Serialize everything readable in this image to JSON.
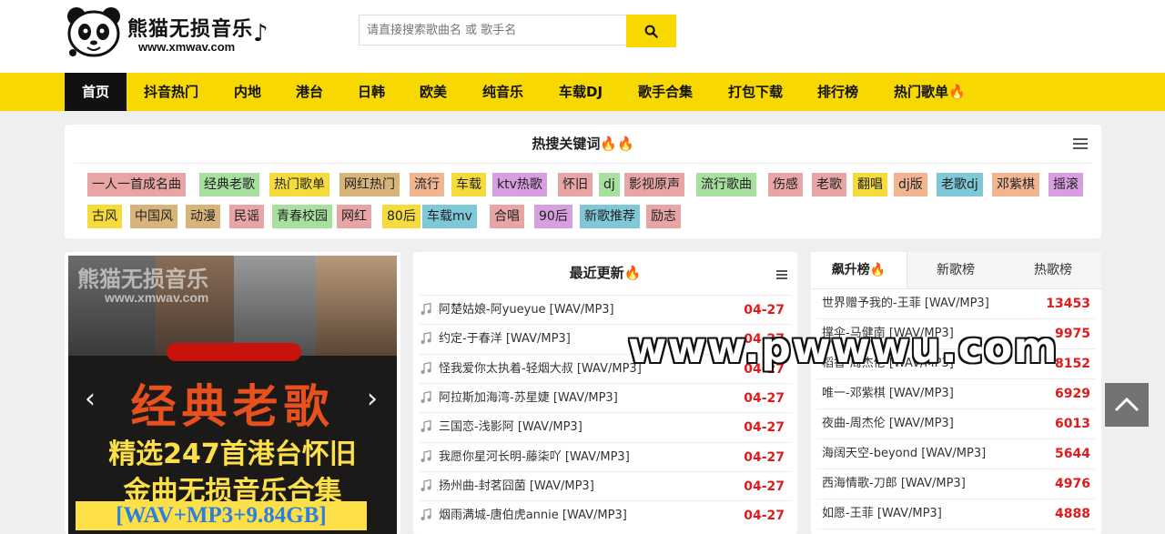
{
  "logo": {
    "title": "熊猫无损音乐",
    "url": "www.xmwav.com"
  },
  "search": {
    "placeholder": "请直接搜索歌曲名 或 歌手名",
    "icon": "search-icon"
  },
  "nav": [
    {
      "label": "首页",
      "active": true
    },
    {
      "label": "抖音热门"
    },
    {
      "label": "内地"
    },
    {
      "label": "港台"
    },
    {
      "label": "日韩"
    },
    {
      "label": "欧美"
    },
    {
      "label": "纯音乐"
    },
    {
      "label": "车载DJ"
    },
    {
      "label": "歌手合集"
    },
    {
      "label": "打包下载"
    },
    {
      "label": "排行榜"
    },
    {
      "label": "热门歌单"
    }
  ],
  "hot_keywords": {
    "title": "热搜关键词",
    "tags": [
      {
        "label": "一人一首成名曲",
        "color": "#e8a5a5"
      },
      {
        "label": "经典老歌",
        "color": "#a8e0a0"
      },
      {
        "label": "热门歌单",
        "color": "#f5dc3c"
      },
      {
        "label": "网红热门",
        "color": "#d8b47a"
      },
      {
        "label": "流行",
        "color": "#f2b592"
      },
      {
        "label": "车载",
        "color": "#f5dc3c"
      },
      {
        "label": "ktv热歌",
        "color": "#d79ee0"
      },
      {
        "label": "怀旧",
        "color": "#e8a5a5"
      },
      {
        "label": "dj",
        "color": "#a8e0a0"
      },
      {
        "label": "影视原声",
        "color": "#e8a5a5"
      },
      {
        "label": "流行歌曲",
        "color": "#a8e0a0"
      },
      {
        "label": "伤感",
        "color": "#e8a5a5"
      },
      {
        "label": "老歌",
        "color": "#e8a5a5"
      },
      {
        "label": "翻唱",
        "color": "#f5dc3c"
      },
      {
        "label": "dj版",
        "color": "#f2b592"
      },
      {
        "label": "老歌dj",
        "color": "#7ec8d8"
      },
      {
        "label": "邓紫棋",
        "color": "#f2b592"
      },
      {
        "label": "摇滚",
        "color": "#d79ee0"
      },
      {
        "label": "古风",
        "color": "#f5dc3c"
      },
      {
        "label": "中国风",
        "color": "#d8b47a"
      },
      {
        "label": "动漫",
        "color": "#d8b47a"
      },
      {
        "label": "民谣",
        "color": "#e8a5a5"
      },
      {
        "label": "青春校园",
        "color": "#a8e0a0"
      },
      {
        "label": "网红",
        "color": "#e8a5a5"
      },
      {
        "label": "80后",
        "color": "#f5dc3c"
      },
      {
        "label": "车载mv",
        "color": "#7ec8d8"
      },
      {
        "label": "合唱",
        "color": "#e8a5a5"
      },
      {
        "label": "90后",
        "color": "#d79ee0"
      },
      {
        "label": "新歌推荐",
        "color": "#7ec8d8"
      },
      {
        "label": "励志",
        "color": "#e8a5a5"
      }
    ]
  },
  "banner": {
    "watermark": "熊猫无损音乐",
    "watermark_url": "www.xmwav.com",
    "headline": "经典老歌",
    "line2": "精选247首港台怀旧",
    "line3": "金曲无损音乐合集",
    "line4": "[WAV+MP3+9.84GB]",
    "prev": "‹",
    "next": "›"
  },
  "recent": {
    "title": "最近更新",
    "items": [
      {
        "name": "阿楚姑娘-阿yueyue [WAV/MP3]",
        "date": "04-27"
      },
      {
        "name": "约定-于春洋 [WAV/MP3]",
        "date": "04-27"
      },
      {
        "name": "怪我爱你太执着-轻烟大叔 [WAV/MP3]",
        "date": "04-27"
      },
      {
        "name": "阿拉斯加海湾-苏星婕 [WAV/MP3]",
        "date": "04-27"
      },
      {
        "name": "三国恋-浅影阿 [WAV/MP3]",
        "date": "04-27"
      },
      {
        "name": "我愿你星河长明-藤柒吖 [WAV/MP3]",
        "date": "04-27"
      },
      {
        "name": "扬州曲-封茗囧菌 [WAV/MP3]",
        "date": "04-27"
      },
      {
        "name": "烟雨满城-唐伯虎annie [WAV/MP3]",
        "date": "04-27"
      }
    ]
  },
  "rank": {
    "tabs": [
      "飙升榜",
      "新歌榜",
      "热歌榜"
    ],
    "items": [
      {
        "name": "世界赠予我的-王菲 [WAV/MP3]",
        "count": "13453"
      },
      {
        "name": "撑伞-马健南 [WAV/MP3]",
        "count": "9975"
      },
      {
        "name": "稻香-周杰伦 [WAV/MP3]",
        "count": "8152"
      },
      {
        "name": "唯一-邓紫棋 [WAV/MP3]",
        "count": "6929"
      },
      {
        "name": "夜曲-周杰伦 [WAV/MP3]",
        "count": "6013"
      },
      {
        "name": "海阔天空-beyond [WAV/MP3]",
        "count": "5644"
      },
      {
        "name": "西海情歌-刀郎 [WAV/MP3]",
        "count": "4976"
      },
      {
        "name": "如愿-王菲 [WAV/MP3]",
        "count": "4888"
      }
    ]
  },
  "overlay_watermark": "www.pwwwu.com",
  "colors": {
    "accent": "#f7d800",
    "count_red": "#e01b1b"
  }
}
